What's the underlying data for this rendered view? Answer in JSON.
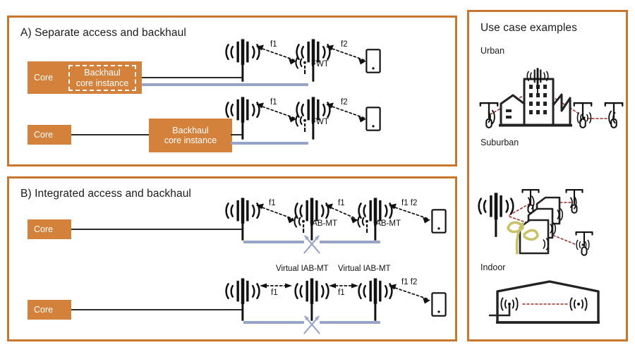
{
  "figure": {
    "panels": {
      "a": {
        "title": "A)  Separate access and backhaul"
      },
      "b": {
        "title": "B)  Integrated access and backhaul"
      },
      "c": {
        "title": "Use case examples"
      }
    }
  },
  "panel_a": {
    "row1": {
      "core_label": "Core",
      "backhaul_box": "Backhaul\ncore instance",
      "backhaul_line1": "Backhaul",
      "backhaul_line2": "core instance",
      "link1_label": "f1",
      "link2_label": "f2",
      "node_label": "FWT"
    },
    "row2": {
      "core_label": "Core",
      "backhaul_line1": "Backhaul",
      "backhaul_line2": "core instance",
      "link1_label": "f1",
      "link2_label": "f2",
      "node_label": "FWT"
    }
  },
  "panel_b": {
    "row1": {
      "core_label": "Core",
      "link1_label": "f1",
      "link2_label": "f1",
      "link3_label": "f1 f2",
      "node1_label": "IAB-MT",
      "node2_label": "IAB-MT"
    },
    "virtual_labels": [
      "Virtual IAB-MT",
      "Virtual IAB-MT"
    ],
    "row2": {
      "core_label": "Core",
      "link1_label": "f1",
      "link2_label": "f1",
      "link3_label": "f1 f2"
    }
  },
  "panel_c": {
    "cases": [
      {
        "name": "Urban"
      },
      {
        "name": "Suburban"
      },
      {
        "name": "Indoor"
      }
    ]
  },
  "icons": {
    "tower": "cell-tower-icon",
    "small_antenna": "small-antenna-icon",
    "ue": "user-equipment-icon",
    "cross_arrows": "crossing-arrows-icon",
    "streetlamp": "streetlamp-small-cell-icon",
    "city": "city-buildings-icon",
    "houses": "suburban-houses-icon",
    "plant": "foliage-icon",
    "building_indoor": "indoor-building-icon"
  },
  "colors": {
    "accent_orange": "#C9772F",
    "box_orange": "#D4813C",
    "blue_bar": "#98A3C8",
    "link_red": "#9E2B2B",
    "wire_dark": "#2b2b2b",
    "foliage": "#C9C06A"
  }
}
